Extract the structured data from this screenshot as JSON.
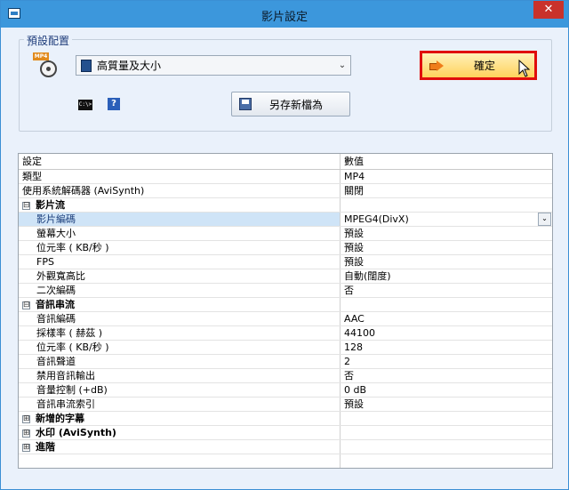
{
  "window": {
    "title": "影片設定",
    "close_glyph": "✕"
  },
  "preset": {
    "legend": "預設配置",
    "file_icon_text": "MP4",
    "selected": "高質量及大小",
    "dropdown_glyph": "⌄",
    "confirm_label": "確定",
    "saveas_label": "另存新檔為",
    "console_icon_text": "C:\\>",
    "help_glyph": "?"
  },
  "icons": {
    "app": "app-window-icon",
    "file": "mp4-file-icon",
    "select": "preset-list-icon",
    "confirm": "arrow-right-icon",
    "cursor": "mouse-cursor-icon",
    "console": "console-icon",
    "help": "help-icon",
    "save": "floppy-disk-icon"
  },
  "grid": {
    "header": {
      "name": "設定",
      "value": "數值"
    },
    "rows": [
      {
        "type": "item",
        "name": "類型",
        "value": "MP4"
      },
      {
        "type": "item",
        "name": "使用系統解碼器 (AviSynth)",
        "value": "關閉"
      },
      {
        "type": "category",
        "expander": "⊟",
        "name": "影片流",
        "value": ""
      },
      {
        "type": "child",
        "name": "影片編碼",
        "value": "MPEG4(DivX)",
        "selected": true,
        "dropdown": "⌄"
      },
      {
        "type": "child",
        "name": "螢幕大小",
        "value": "預設"
      },
      {
        "type": "child",
        "name": "位元率 ( KB/秒 )",
        "value": "預設"
      },
      {
        "type": "child",
        "name": "FPS",
        "value": "預設"
      },
      {
        "type": "child",
        "name": "外觀寬高比",
        "value": "自動(闊度)"
      },
      {
        "type": "child",
        "name": "二次編碼",
        "value": "否"
      },
      {
        "type": "category",
        "expander": "⊟",
        "name": "音訊串流",
        "value": ""
      },
      {
        "type": "child",
        "name": "音訊編碼",
        "value": "AAC"
      },
      {
        "type": "child",
        "name": "採樣率 ( 赫茲 )",
        "value": "44100"
      },
      {
        "type": "child",
        "name": "位元率 ( KB/秒 )",
        "value": "128"
      },
      {
        "type": "child",
        "name": "音訊聲道",
        "value": "2"
      },
      {
        "type": "child",
        "name": "禁用音訊輸出",
        "value": "否"
      },
      {
        "type": "child",
        "name": "音量控制 (+dB)",
        "value": "0 dB"
      },
      {
        "type": "child",
        "name": "音訊串流索引",
        "value": "預設"
      },
      {
        "type": "category",
        "expander": "⊞",
        "name": "新增的字幕",
        "value": ""
      },
      {
        "type": "category",
        "expander": "⊞",
        "name": "水印 (AviSynth)",
        "value": ""
      },
      {
        "type": "category",
        "expander": "⊞",
        "name": "進階",
        "value": ""
      }
    ]
  },
  "colors": {
    "titlebar": "#3c97dc",
    "close": "#c9322b",
    "confirm_highlight": "#e00d0d",
    "confirm_fill": "#ffd25c",
    "selected_row": "#cfe4f7"
  }
}
